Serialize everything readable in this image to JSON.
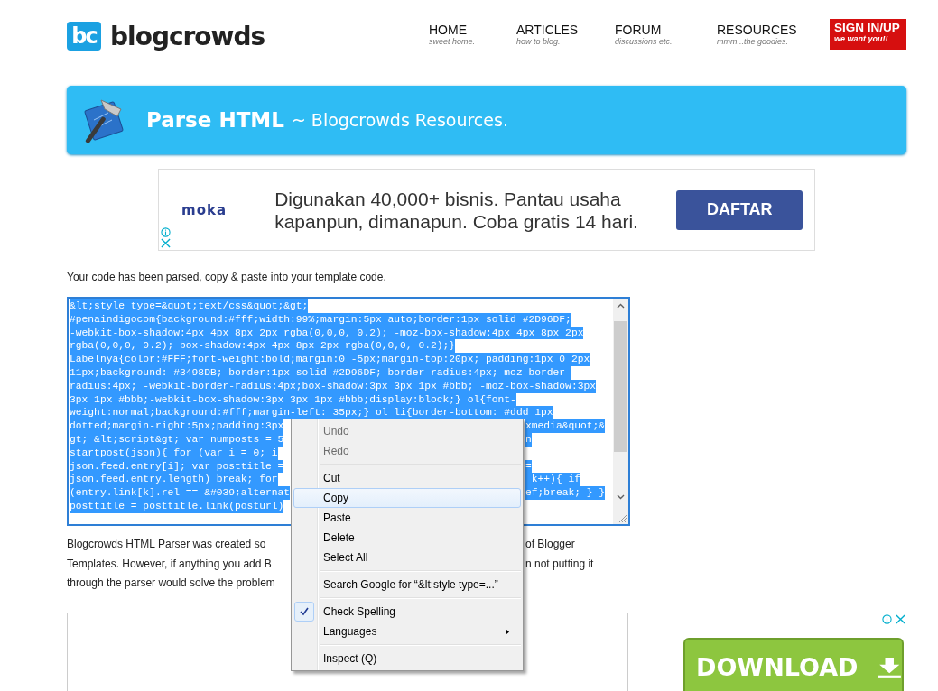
{
  "header": {
    "logo_mark": "bc",
    "logo_text": "blogcrowds",
    "nav": [
      {
        "title": "HOME",
        "subtitle": "sweet home."
      },
      {
        "title": "ARTICLES",
        "subtitle": "how to blog."
      },
      {
        "title": "FORUM",
        "subtitle": "discussions etc."
      },
      {
        "title": "RESOURCES",
        "subtitle": "mmm...the goodies."
      }
    ],
    "signin": {
      "title": "SIGN IN/UP",
      "subtitle": "we want you!!"
    }
  },
  "banner": {
    "title": "Parse HTML",
    "subtitle": "~ Blogcrowds Resources."
  },
  "ad": {
    "brand": "moka",
    "text": "Digunakan 40,000+ bisnis. Pantau usaha kapanpun, dimanapun. Coba gratis 14 hari.",
    "button": "DAFTAR"
  },
  "intro": "Your code has been parsed, copy & paste into your template code.",
  "code": {
    "lines": [
      {
        "text": "&lt;style type=&quot;text/css&quot;&gt;"
      },
      {
        "text": "#penaindigocom{background:#fff;width:99%;margin:5px auto;border:1px solid #2D96DF;"
      },
      {
        "text": "-webkit-box-shadow:4px 4px 8px 2px rgba(0,0,0, 0.2); -moz-box-shadow:4px 4px 8px 2px"
      },
      {
        "text": "rgba(0,0,0, 0.2); box-shadow:4px 4px 8px 2px rgba(0,0,0, 0.2);}"
      },
      {
        "text": "Labelnya{color:#FFF;font-weight:bold;margin:0 -5px;margin-top:20px; padding:1px 0 2px"
      },
      {
        "text": "11px;background: #3498DB; border:1px solid #2D96DF; border-radius:4px;-moz-border-"
      },
      {
        "text": "radius:4px; -webkit-border-radius:4px;box-shadow:3px 3px 1px #bbb; -moz-box-shadow:3px"
      },
      {
        "text": "3px 1px #bbb;-webkit-box-shadow:3px 3px 1px #bbb;display:block;} ol{font-"
      },
      {
        "text": "weight:normal;background:#fff;margin-left: 35px;} ol li{border-bottom: #ddd 1px"
      },
      {
        "text": "dotted;margin-right:5px;padding:3px",
        "right": "xmedia&quot;&"
      },
      {
        "text": "gt; &lt;script&gt; var numposts = 5",
        "right": "n"
      },
      {
        "text": "startpost(json){ for (var i = 0; i"
      },
      {
        "text": "json.feed.entry[i]; var posttitle =",
        "right": "="
      },
      {
        "text": "json.feed.entry.length) break; for",
        "right": " k++){ if"
      },
      {
        "text": "(entry.link[k].rel == &#039;alternat",
        "right": "ef;break; } }"
      },
      {
        "text": "posttitle = posttitle.link(posturl)"
      }
    ]
  },
  "note": {
    "lines": [
      {
        "text": "Blogcrowds HTML Parser was created so",
        "right": "of Blogger"
      },
      {
        "text": "Templates. However, if anything you add B",
        "right": "n not putting it"
      },
      {
        "text": "through the parser would solve the problem"
      }
    ]
  },
  "context_menu": {
    "items": [
      {
        "kind": "item",
        "label": "Undo",
        "disabled": true,
        "selected": false,
        "checked": false
      },
      {
        "kind": "item",
        "label": "Redo",
        "disabled": true,
        "selected": false,
        "checked": false
      },
      {
        "kind": "separator"
      },
      {
        "kind": "item",
        "label": "Cut",
        "disabled": false,
        "selected": false,
        "checked": false
      },
      {
        "kind": "item",
        "label": "Copy",
        "disabled": false,
        "selected": true,
        "checked": false
      },
      {
        "kind": "item",
        "label": "Paste",
        "disabled": false,
        "selected": false,
        "checked": false
      },
      {
        "kind": "item",
        "label": "Delete",
        "disabled": false,
        "selected": false,
        "checked": false
      },
      {
        "kind": "item",
        "label": "Select All",
        "disabled": false,
        "selected": false,
        "checked": false
      },
      {
        "kind": "separator"
      },
      {
        "kind": "item",
        "label": "Search Google for “&lt;style type=...”",
        "disabled": false,
        "selected": false,
        "checked": false
      },
      {
        "kind": "separator"
      },
      {
        "kind": "item",
        "label": "Check Spelling",
        "disabled": false,
        "selected": false,
        "checked": true
      },
      {
        "kind": "submenu",
        "label": "Languages",
        "disabled": false,
        "selected": false,
        "checked": false
      },
      {
        "kind": "separator"
      },
      {
        "kind": "item",
        "label": "Inspect (Q)",
        "disabled": false,
        "selected": false,
        "checked": false
      }
    ]
  },
  "side_ad": {
    "button": "DOWNLOAD"
  }
}
